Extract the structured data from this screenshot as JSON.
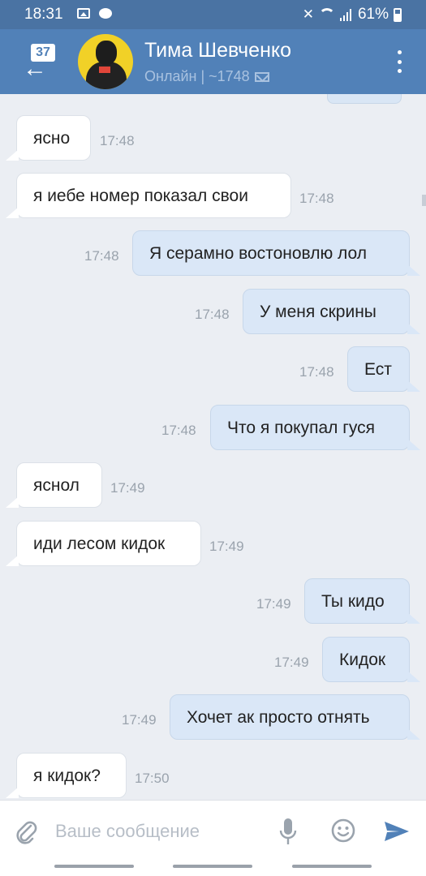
{
  "status_bar": {
    "time": "18:31",
    "battery": "61%",
    "battery_level": 0.61
  },
  "header": {
    "unread_badge": "37",
    "contact_name": "Тима Шевченко",
    "contact_status": "Онлайн | ~1748"
  },
  "messages": [
    {
      "dir": "in",
      "text": "ясно",
      "time": "17:48"
    },
    {
      "dir": "in",
      "text": "я иебе номер показал свои",
      "time": "17:48"
    },
    {
      "dir": "out",
      "text": "Я серамно востоновлю лол",
      "time": "17:48"
    },
    {
      "dir": "out",
      "text": "У меня скрины",
      "time": "17:48"
    },
    {
      "dir": "out",
      "text": "Ест",
      "time": "17:48"
    },
    {
      "dir": "out",
      "text": "Что я покупал гуся",
      "time": "17:48"
    },
    {
      "dir": "in",
      "text": "яснол",
      "time": "17:49"
    },
    {
      "dir": "in",
      "text": "иди лесом кидок",
      "time": "17:49"
    },
    {
      "dir": "out",
      "text": "Ты кидо",
      "time": "17:49"
    },
    {
      "dir": "out",
      "text": "Кидок",
      "time": "17:49"
    },
    {
      "dir": "out",
      "text": "Хочет ак просто отнять",
      "time": "17:49"
    },
    {
      "dir": "in",
      "text": "я кидок?",
      "time": "17:50"
    }
  ],
  "composer": {
    "placeholder": "Ваше сообщение",
    "value": ""
  },
  "colors": {
    "header": "#5181b8",
    "status_bar": "#4a73a3",
    "out_bubble": "#dae7f7",
    "in_bubble": "#ffffff",
    "background": "#ebeef3"
  },
  "icons": [
    "back-arrow-icon",
    "mail-icon",
    "more-vertical-icon",
    "attach-icon",
    "microphone-icon",
    "emoji-icon",
    "send-icon"
  ]
}
